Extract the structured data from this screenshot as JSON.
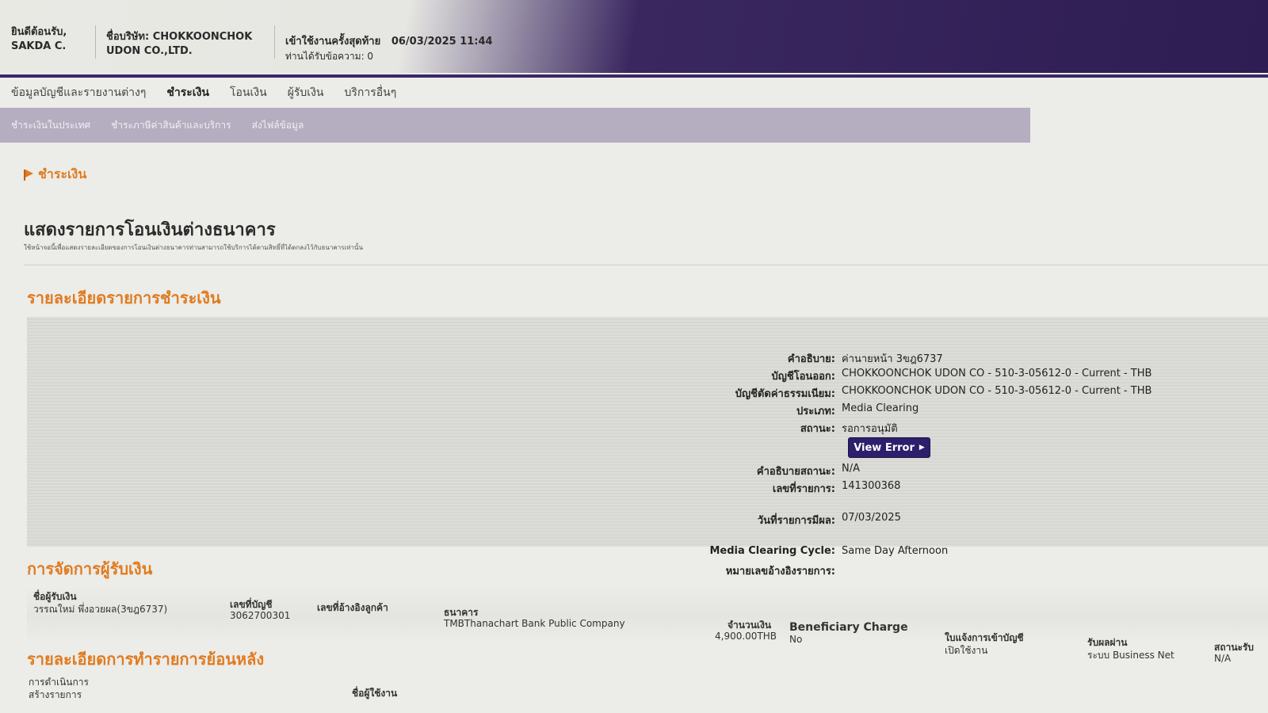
{
  "header": {
    "welcome_line1": "ยินดีต้อนรับ,",
    "welcome_line2": "SAKDA C.",
    "company_line1": "ชื่อบริษัท: CHOKKOONCHOK",
    "company_line2": "UDON CO.,LTD.",
    "last_login_label": "เข้าใช้งานครั้งสุดท้าย",
    "last_login_value": "06/03/2025 11:44",
    "messages": "ท่านได้รับข้อความ: 0"
  },
  "main_nav": [
    {
      "label": "ข้อมูลบัญชีและรายงานต่างๆ"
    },
    {
      "label": "ชำระเงิน"
    },
    {
      "label": "โอนเงิน"
    },
    {
      "label": "ผู้รับเงิน"
    },
    {
      "label": "บริการอื่นๆ"
    }
  ],
  "sub_nav": [
    {
      "label": "ชำระเงินในประเทศ"
    },
    {
      "label": "ชำระภาษีค่าสินค้าและบริการ"
    },
    {
      "label": "ส่งไฟล์ข้อมูล"
    }
  ],
  "breadcrumb": "ชำระเงิน",
  "page": {
    "title": "แสดงรายการโอนเงินต่างธนาคาร",
    "description": "ใช้หน้าจอนี้เพื่อแสดงรายละเอียดของการโอนเงินต่างธนาคารท่านสามารถใช้บริการได้ตามสิทธิ์ที่ได้ตกลงไว้กับธนาคารเท่านั้น"
  },
  "payment_details": {
    "section_title": "รายละเอียดรายการชำระเงิน",
    "fields": [
      {
        "label": "คำอธิบาย:",
        "value": "ค่านายหน้า 3ขฎ6737"
      },
      {
        "label": "บัญชีโอนออก:",
        "value": "CHOKKOONCHOK UDON CO - 510-3-05612-0 - Current - THB"
      },
      {
        "label": "บัญชีตัดค่าธรรมเนียม:",
        "value": "CHOKKOONCHOK UDON CO - 510-3-05612-0 - Current - THB"
      },
      {
        "label": "ประเภท:",
        "value": "Media Clearing"
      },
      {
        "label": "สถานะ:",
        "value": "รอการอนุมัติ"
      },
      {
        "label": "คำอธิบายสถานะ:",
        "value": "N/A"
      },
      {
        "label": "เลขที่รายการ:",
        "value": "141300368"
      },
      {
        "label": "วันที่รายการมีผล:",
        "value": "07/03/2025"
      },
      {
        "label": "Media Clearing Cycle:",
        "value": "Same Day Afternoon"
      },
      {
        "label": "หมายเลขอ้างอิงรายการ:",
        "value": ""
      }
    ],
    "view_error_label": "View Error"
  },
  "payee_management": {
    "section_title": "การจัดการผู้รับเงิน",
    "headers": {
      "name": "ชื่อผู้รับเงิน",
      "account_no": "เลขที่บัญชี",
      "customer_ref": "เลขที่อ้างอิงลูกค้า",
      "bank": "ธนาคาร",
      "amount": "จำนวนเงิน",
      "beneficiary_charge": "Beneficiary Charge",
      "credit_advice": "ใบแจ้งการเข้าบัญชี",
      "receive_via": "รับผลผ่าน",
      "receive_status": "สถานะรับ"
    },
    "row": {
      "name": "วรรณใหม่ พึ่งอวยผล(3ขฎ6737)",
      "account_no": "3062700301",
      "bank": "TMBThanachart Bank Public Company",
      "amount": "4,900.00THB",
      "beneficiary_charge": "No",
      "credit_advice": "เปิดใช้งาน",
      "receive_via": "ระบบ Business Net",
      "receive_status": "N/A"
    }
  },
  "history": {
    "section_title": "รายละเอียดการทำรายการย้อนหลัง",
    "col_action_line1": "การดำเนินการ",
    "col_action_line2": "สร้างรายการ",
    "col_user": "ชื่อผู้ใช้งาน"
  }
}
